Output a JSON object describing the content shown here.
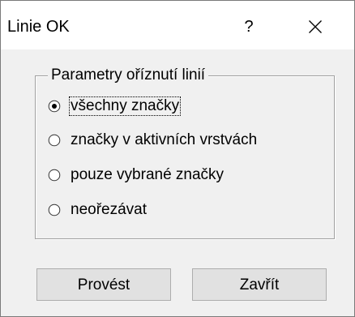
{
  "window": {
    "title": "Linie OK",
    "help_label": "?",
    "close_icon": "close-icon"
  },
  "group": {
    "legend": "Parametry oříznutí linií",
    "options": [
      {
        "label": "všechny značky",
        "checked": true
      },
      {
        "label": "značky v aktivních vrstvách",
        "checked": false
      },
      {
        "label": "pouze vybrané značky",
        "checked": false
      },
      {
        "label": "neořezávat",
        "checked": false
      }
    ]
  },
  "buttons": {
    "execute_label": "Provést",
    "close_label": "Zavřít"
  },
  "colors": {
    "dialog_bg": "#f0f0f0",
    "titlebar_bg": "#ffffff",
    "button_bg": "#e1e1e1",
    "button_border": "#adadad"
  }
}
